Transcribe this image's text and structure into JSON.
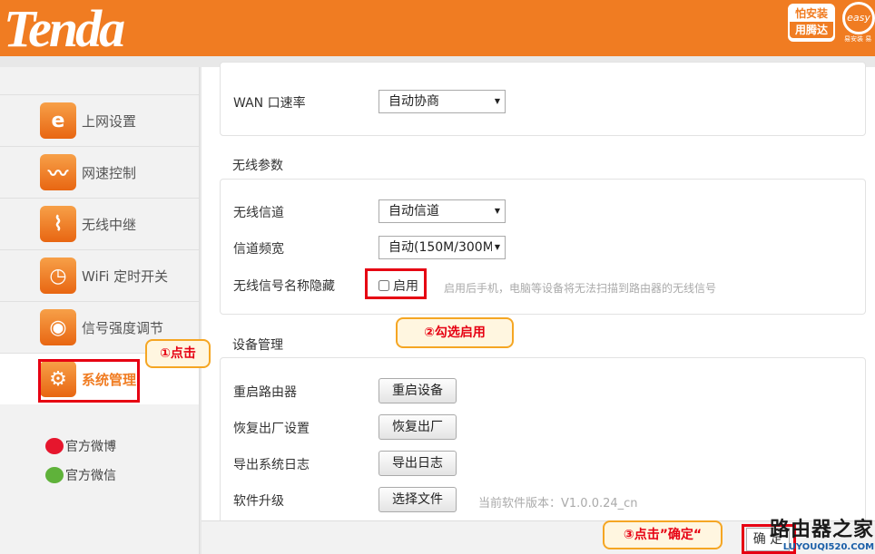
{
  "header": {
    "brand": "Tenda",
    "badge_line1": "怕安装",
    "badge_line2": "用腾达",
    "easy_text": "easy",
    "easy_caption": "易安装 易"
  },
  "sidebar": {
    "items": [
      {
        "label": "上网设置",
        "icon": "e-icon"
      },
      {
        "label": "网速控制",
        "icon": "speed-wave-icon"
      },
      {
        "label": "无线中继",
        "icon": "antenna-icon"
      },
      {
        "label": "WiFi 定时开关",
        "icon": "timer-icon"
      },
      {
        "label": "信号强度调节",
        "icon": "signal-icon"
      },
      {
        "label": "系统管理",
        "icon": "gear-icon",
        "active": true
      }
    ],
    "weibo": "官方微博",
    "weixin": "官方微信"
  },
  "wan": {
    "label": "WAN 口速率",
    "value": "自动协商"
  },
  "wireless": {
    "title": "无线参数",
    "channel_label": "无线信道",
    "channel_value": "自动信道",
    "bandwidth_label": "信道频宽",
    "bandwidth_value": "自动(150M/300M",
    "hide_ssid_label": "无线信号名称隐藏",
    "hide_ssid_checkbox": "启用",
    "hide_ssid_hint": "启用后手机，电脑等设备将无法扫描到路由器的无线信号"
  },
  "device": {
    "title": "设备管理",
    "reboot_label": "重启路由器",
    "reboot_button": "重启设备",
    "factory_label": "恢复出厂设置",
    "factory_button": "恢复出厂",
    "log_label": "导出系统日志",
    "log_button": "导出日志",
    "upgrade_label": "软件升级",
    "upgrade_button": "选择文件",
    "version_text": "当前软件版本：V1.0.0.24_cn"
  },
  "footer": {
    "ok_button": "确 定"
  },
  "annotations": {
    "step1": "①点击",
    "step2": "②勾选启用",
    "step3": "③点击”确定“"
  },
  "watermark": {
    "line1": "路由器之家",
    "line2": "LUYOUQI520.COM"
  }
}
